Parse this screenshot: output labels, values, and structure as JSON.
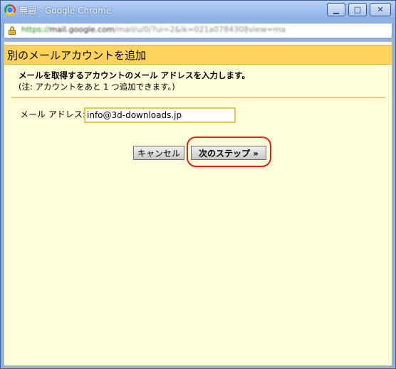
{
  "window": {
    "title": "無題 - Google Chrome",
    "controls": {
      "minimize": "▁",
      "maximize": "□",
      "close": "✕"
    }
  },
  "addressbar": {
    "url_scheme": "https://",
    "url_host": "mail.google.com",
    "url_path": "/mail/u/0/?ui=2&ik=021a0784308view=ma"
  },
  "dialog": {
    "title": "別のメールアカウントを追加",
    "instruction": "メールを取得するアカウントのメール アドレスを入力します。",
    "note": "(注: アカウントをあと 1 つ追加できます。)",
    "email_label": "メール アドレス:",
    "email_value": "info@3d-downloads.jp",
    "cancel_label": "キャンセル",
    "next_label": "次のステップ »"
  },
  "colors": {
    "header_bg": "#ffd35c",
    "content_bg": "#fffed9",
    "highlight": "#e0201c",
    "divider": "#f6c46a"
  }
}
